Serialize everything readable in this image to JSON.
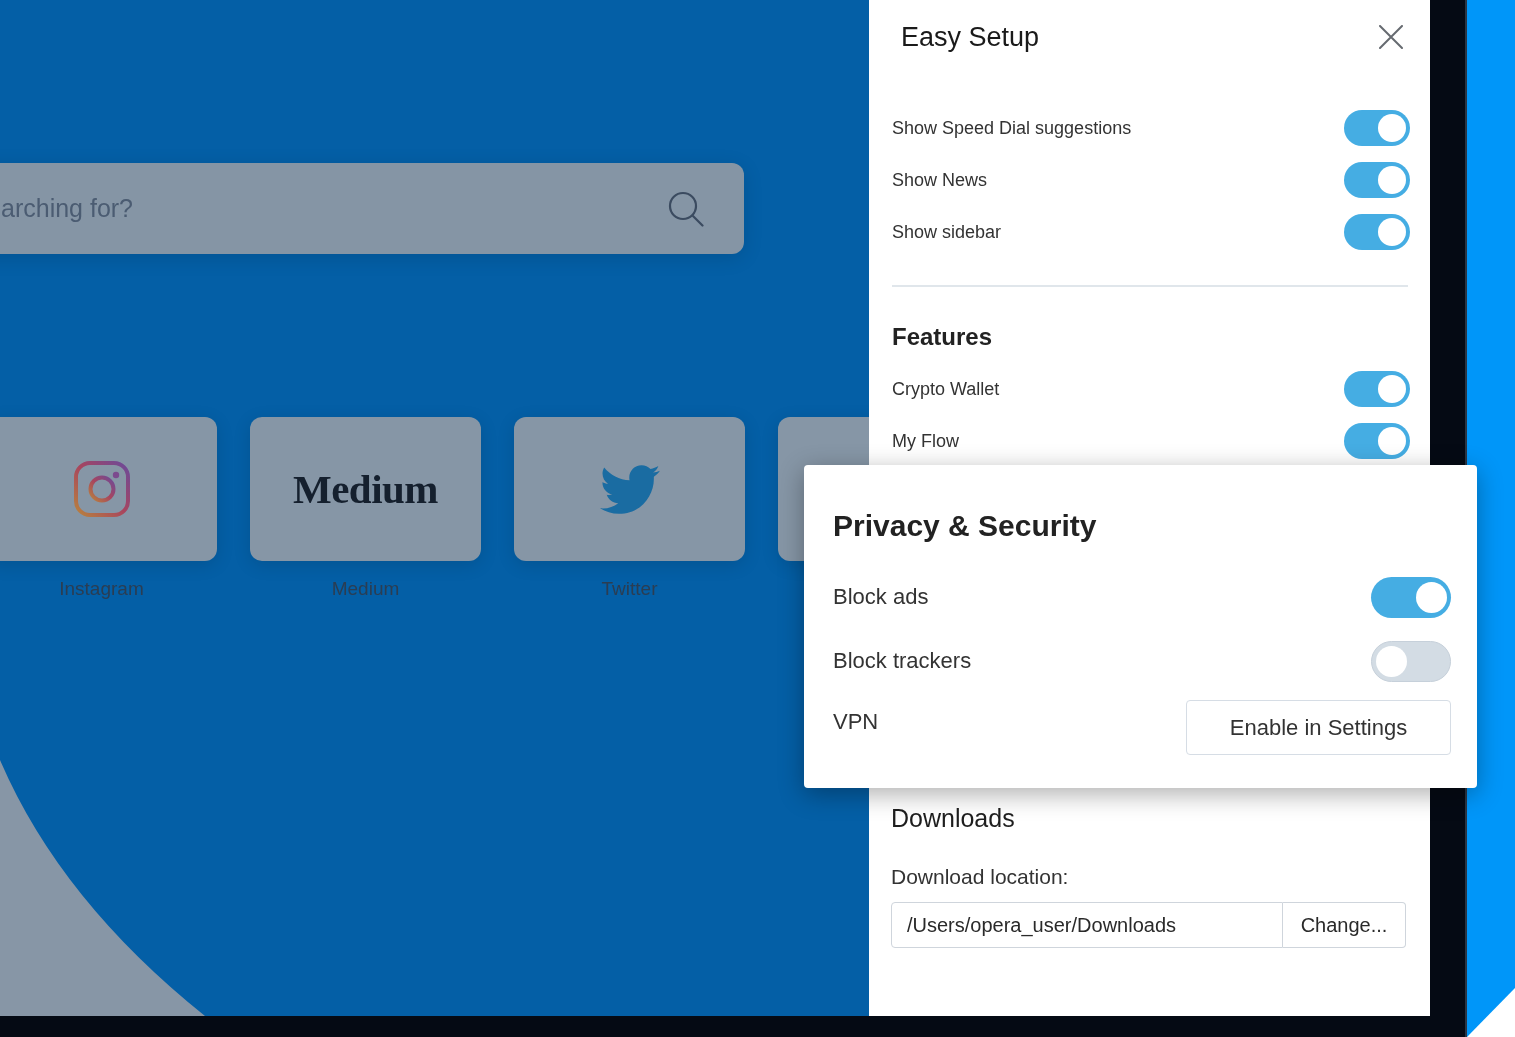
{
  "start_page": {
    "search": {
      "placeholder": "arching for?"
    },
    "speed_dial": [
      {
        "kind": "camera",
        "label": "Instagram"
      },
      {
        "kind": "wordmark",
        "wordmark": "Medium",
        "label": "Medium"
      },
      {
        "kind": "bird",
        "label": "Twitter"
      },
      {
        "kind": "blank"
      }
    ]
  },
  "easy_setup": {
    "title": "Easy Setup",
    "toggles": [
      {
        "label": "Show Speed Dial suggestions",
        "on": true
      },
      {
        "label": "Show News",
        "on": true
      },
      {
        "label": "Show sidebar",
        "on": true
      }
    ],
    "features": {
      "heading": "Features",
      "toggles": [
        {
          "label": "Crypto Wallet",
          "on": true
        },
        {
          "label": "My Flow",
          "on": true
        }
      ]
    },
    "downloads": {
      "heading": "Downloads",
      "location_label": "Download location:",
      "location": "/Users/opera_user/Downloads",
      "change_button": "Change..."
    }
  },
  "privacy_security": {
    "heading": "Privacy & Security",
    "rows": [
      {
        "kind": "toggle",
        "label": "Block ads",
        "on": true
      },
      {
        "kind": "toggle",
        "label": "Block trackers",
        "on": false
      },
      {
        "kind": "button",
        "label": "VPN",
        "button": "Enable in Settings"
      }
    ]
  }
}
